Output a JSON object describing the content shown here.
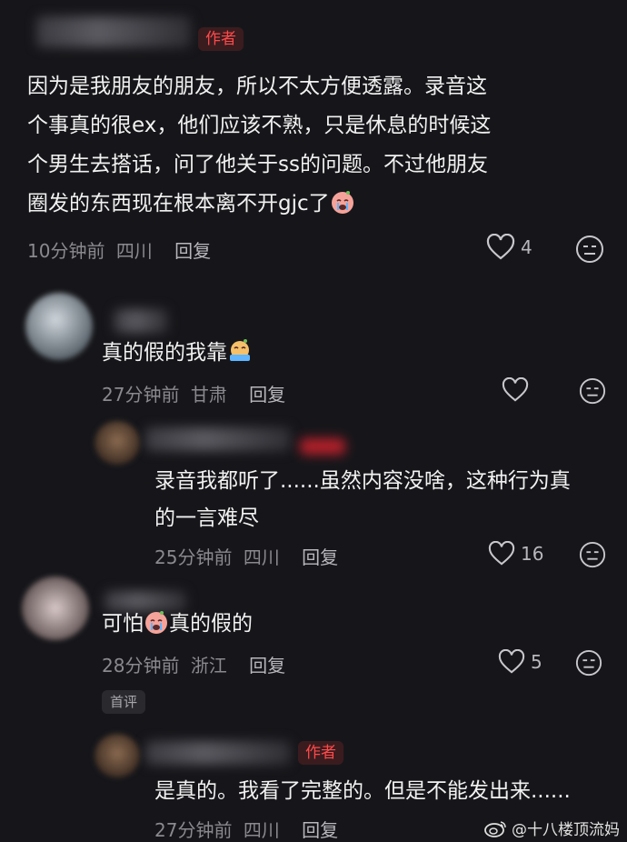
{
  "comments": [
    {
      "author_badge": "作者",
      "lines": [
        "因为是我朋友的朋友，所以不太方便透露。录音这",
        "个事真的很ex，他们应该不熟，只是休息的时候这",
        "个男生去搭话，问了他关于ss的问题。不过他朋友",
        "圈发的东西现在根本离不开gjc了"
      ],
      "time": "10分钟前",
      "location": "四川",
      "reply": "回复",
      "likes": "4"
    },
    {
      "lines": [
        "真的假的我靠"
      ],
      "time": "27分钟前",
      "location": "甘肃",
      "reply": "回复",
      "likes": ""
    },
    {
      "lines": [
        "录音我都听了......虽然内容没啥，这种行为真",
        "的一言难尽"
      ],
      "time": "25分钟前",
      "location": "四川",
      "reply": "回复",
      "likes": "16"
    },
    {
      "lines_pre": "可怕",
      "lines_post": "真的假的",
      "time": "28分钟前",
      "location": "浙江",
      "reply": "回复",
      "likes": "5",
      "first_badge": "首评"
    },
    {
      "author_badge": "作者",
      "lines": [
        "是真的。我看了完整的。但是不能发出来......"
      ],
      "time": "27分钟前",
      "location": "四川",
      "reply": "回复"
    }
  ],
  "watermark": "@十八楼顶流妈",
  "colors": {
    "background": "#16161a",
    "author_red": "#ff4a4a",
    "meta_gray": "#8a8a8e"
  },
  "icons": [
    "heart-icon",
    "dislike-face-icon",
    "crying-emoji-icon",
    "weibo-logo-icon"
  ]
}
